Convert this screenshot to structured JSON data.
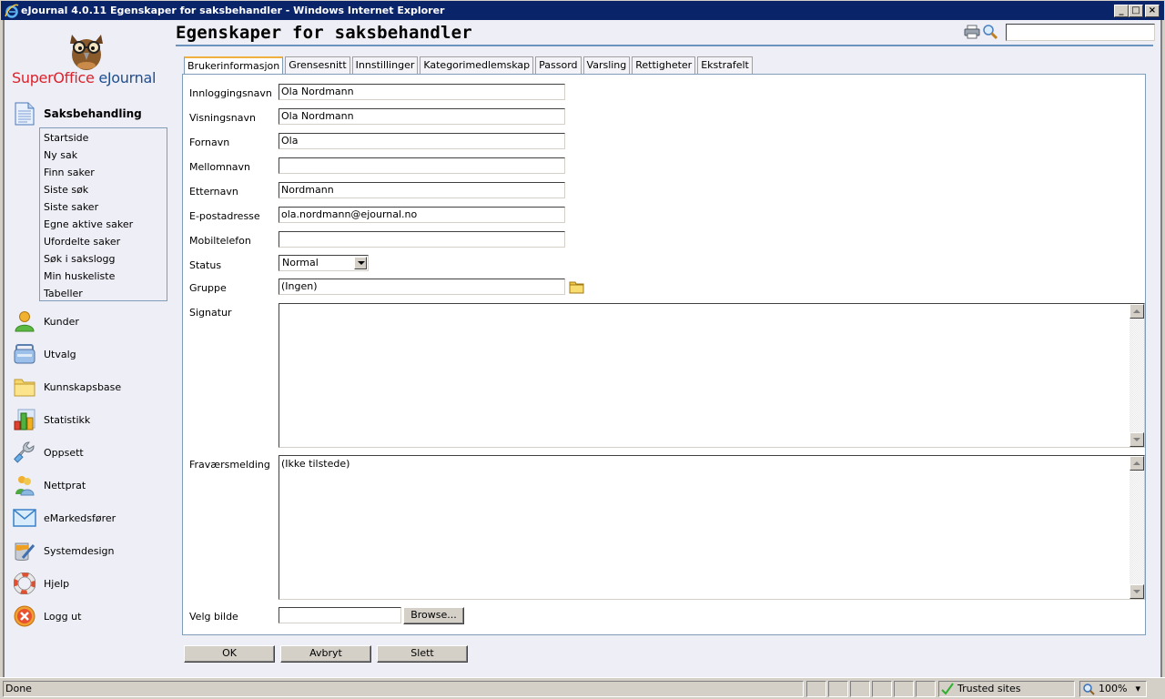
{
  "window": {
    "title": "eJournal 4.0.11 Egenskaper for saksbehandler - Windows Internet Explorer",
    "minimize": "_",
    "maximize": "□",
    "close": "×"
  },
  "brand": {
    "name_part1": "SuperOffice",
    "name_part2": " eJournal",
    "colors": {
      "red": "#d9232d",
      "blue": "#1f4e91"
    }
  },
  "sidebar": {
    "active_section": {
      "label": "Saksbehandling",
      "icon": "document-icon"
    },
    "subitems": [
      "Startside",
      "Ny sak",
      "Finn saker",
      "Siste søk",
      "Siste saker",
      "Egne aktive saker",
      "Ufordelte saker",
      "Søk i sakslogg",
      "Min huskeliste",
      "Tabeller"
    ],
    "sections": [
      {
        "label": "Kunder",
        "icon": "customer-icon"
      },
      {
        "label": "Utvalg",
        "icon": "basket-icon"
      },
      {
        "label": "Kunnskapsbase",
        "icon": "folder-icon"
      },
      {
        "label": "Statistikk",
        "icon": "chart-icon"
      },
      {
        "label": "Oppsett",
        "icon": "wrench-icon"
      },
      {
        "label": "Nettprat",
        "icon": "chat-users-icon"
      },
      {
        "label": "eMarkedsfører",
        "icon": "envelope-icon"
      },
      {
        "label": "Systemdesign",
        "icon": "paint-icon"
      },
      {
        "label": "Hjelp",
        "icon": "lifebuoy-icon"
      },
      {
        "label": "Logg ut",
        "icon": "logout-icon"
      }
    ]
  },
  "header": {
    "title": "Egenskaper for saksbehandler",
    "search_value": ""
  },
  "tabs": [
    {
      "label": "Brukerinformasjon",
      "active": true
    },
    {
      "label": "Grensesnitt",
      "active": false
    },
    {
      "label": "Innstillinger",
      "active": false
    },
    {
      "label": "Kategorimedlemskap",
      "active": false
    },
    {
      "label": "Passord",
      "active": false
    },
    {
      "label": "Varsling",
      "active": false
    },
    {
      "label": "Rettigheter",
      "active": false
    },
    {
      "label": "Ekstrafelt",
      "active": false
    }
  ],
  "form": {
    "login_name": {
      "label": "Innloggingsnavn",
      "value": "Ola Nordmann"
    },
    "display_name": {
      "label": "Visningsnavn",
      "value": "Ola Nordmann"
    },
    "first_name": {
      "label": "Fornavn",
      "value": "Ola"
    },
    "middle_name": {
      "label": "Mellomnavn",
      "value": ""
    },
    "last_name": {
      "label": "Etternavn",
      "value": "Nordmann"
    },
    "email": {
      "label": "E-postadresse",
      "value": "ola.nordmann@ejournal.no"
    },
    "mobile": {
      "label": "Mobiltelefon",
      "value": ""
    },
    "status": {
      "label": "Status",
      "value": "Normal"
    },
    "group": {
      "label": "Gruppe",
      "value": "(Ingen)"
    },
    "signature": {
      "label": "Signatur",
      "value": ""
    },
    "absence_message": {
      "label": "Fraværsmelding",
      "value": "(Ikke tilstede)"
    },
    "picture": {
      "label": "Velg bilde",
      "value": "",
      "browse_label": "Browse..."
    }
  },
  "actions": {
    "ok": "OK",
    "cancel": "Avbryt",
    "delete": "Slett"
  },
  "statusbar": {
    "status": "Done",
    "zone": "Trusted sites",
    "zoom": "100%"
  }
}
